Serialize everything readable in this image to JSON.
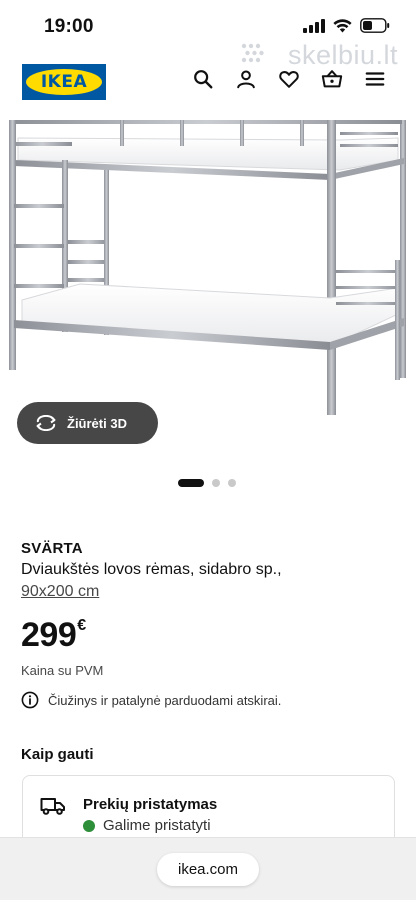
{
  "status_bar": {
    "time": "19:00"
  },
  "watermark": {
    "text": "skelbiu.lt"
  },
  "header": {
    "logo_text": "IKEA",
    "icons": [
      "search-icon",
      "user-icon",
      "heart-icon",
      "basket-icon",
      "menu-icon"
    ]
  },
  "hero": {
    "view_3d_label": "Žiūrėti 3D",
    "carousel": {
      "total": 3,
      "active": 1
    }
  },
  "product": {
    "name": "SVÄRTA",
    "description": "Dviaukštės lovos rėmas, sidabro sp.,",
    "size": "90x200 cm",
    "price": "299",
    "currency": "€",
    "price_note": "Kaina su PVM",
    "info_note": "Čiužinys ir patalynė parduodami atskirai."
  },
  "delivery": {
    "section_title": "Kaip gauti",
    "title": "Prekių pristatymas",
    "status": "Galime pristatyti",
    "status_color": "#2e8f3a"
  },
  "browser": {
    "url": "ikea.com"
  },
  "colors": {
    "brand_blue": "#0058a3",
    "brand_yellow": "#ffdb00"
  }
}
